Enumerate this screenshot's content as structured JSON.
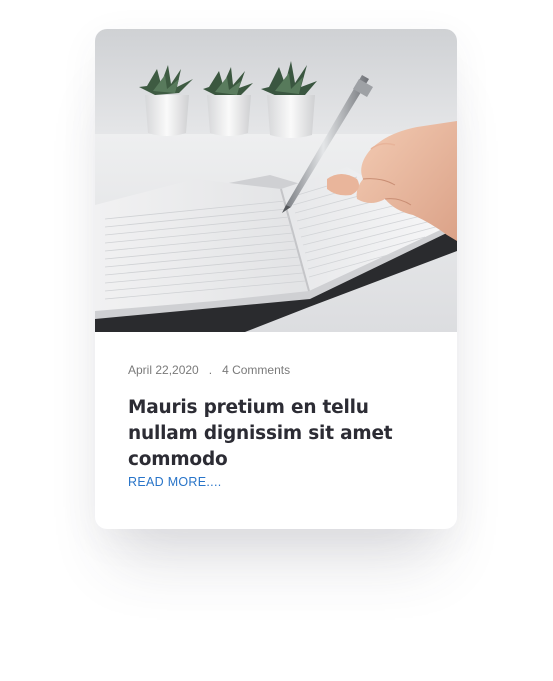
{
  "card": {
    "image_alt": "Hand writing with a pen in an open notebook, potted succulents in background",
    "date": "April 22,2020",
    "separator": ".",
    "comments": "4 Comments",
    "title": "Mauris pretium en tellu nullam dignissim sit amet commodo",
    "read_more": "READ MORE...."
  },
  "colors": {
    "accent": "#2874c8",
    "title": "#2c2c34",
    "meta": "#7a7a7a"
  }
}
